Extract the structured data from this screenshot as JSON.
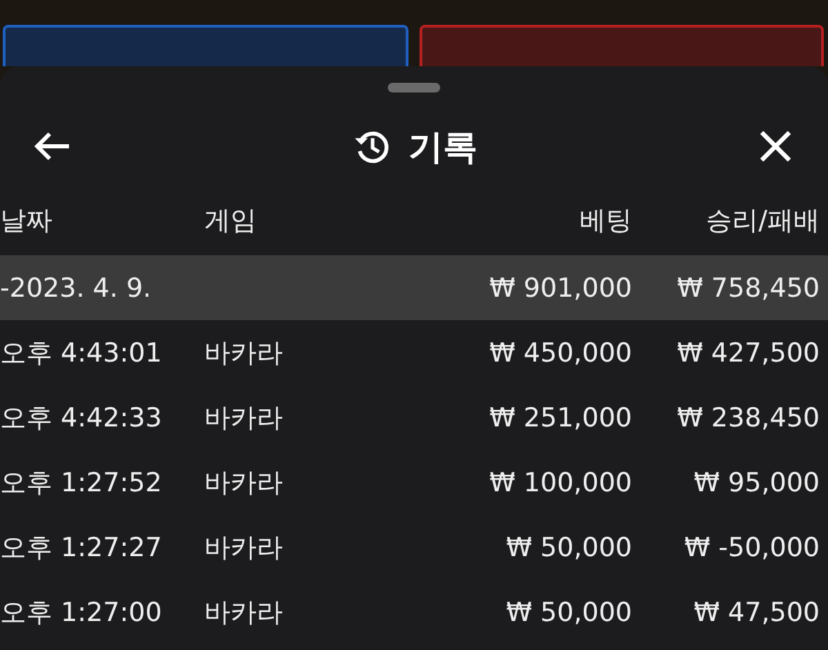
{
  "sheet": {
    "title": "기록"
  },
  "columns": [
    "날짜",
    "게임",
    "베팅",
    "승리/패배"
  ],
  "summary": {
    "date": "-2023. 4. 9.",
    "bet": "₩ 901,000",
    "result": "₩ 758,450"
  },
  "rows": [
    {
      "time": "오후 4:43:01",
      "game": "바카라",
      "bet": "₩ 450,000",
      "result": "₩ 427,500"
    },
    {
      "time": "오후 4:42:33",
      "game": "바카라",
      "bet": "₩ 251,000",
      "result": "₩ 238,450"
    },
    {
      "time": "오후 1:27:52",
      "game": "바카라",
      "bet": "₩ 100,000",
      "result": "₩ 95,000"
    },
    {
      "time": "오후 1:27:27",
      "game": "바카라",
      "bet": "₩ 50,000",
      "result": "₩ -50,000"
    },
    {
      "time": "오후 1:27:00",
      "game": "바카라",
      "bet": "₩ 50,000",
      "result": "₩ 47,500"
    }
  ]
}
